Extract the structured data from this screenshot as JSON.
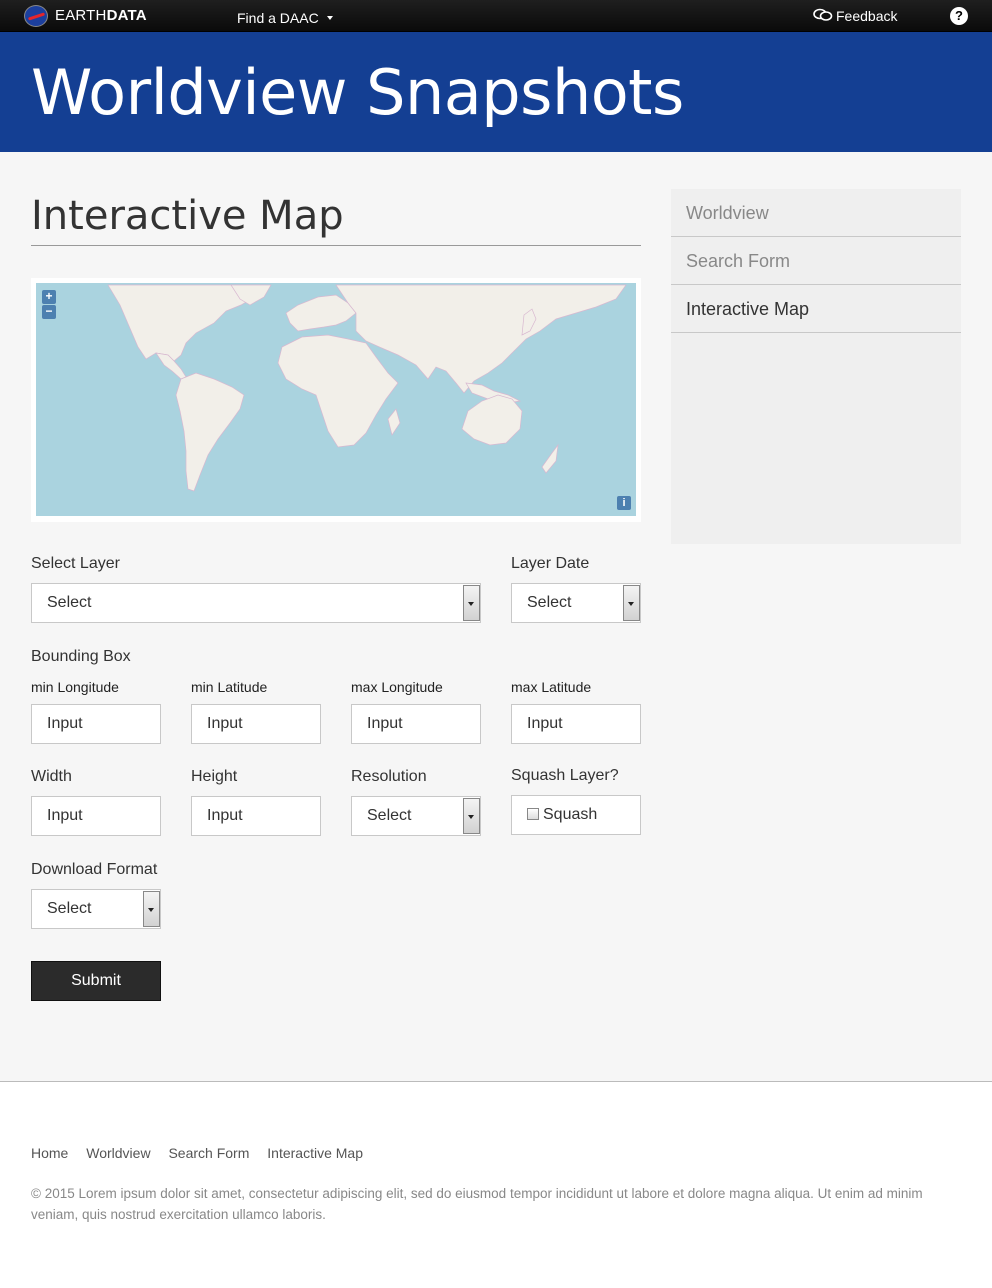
{
  "topbar": {
    "brand_light": "EARTH",
    "brand_bold": "DATA",
    "find_daac": "Find a DAAC",
    "feedback": "Feedback",
    "help": "?"
  },
  "banner": {
    "title": "Worldview Snapshots"
  },
  "main": {
    "page_title": "Interactive Map",
    "map": {
      "zoom_in": "+",
      "zoom_out": "−",
      "info": "i"
    },
    "select_layer": {
      "label": "Select Layer",
      "value": "Select"
    },
    "layer_date": {
      "label": "Layer Date",
      "value": "Select"
    },
    "bounding_box": {
      "label": "Bounding Box",
      "min_longitude": {
        "label": "min Longitude",
        "value": "Input"
      },
      "min_latitude": {
        "label": "min Latitude",
        "value": "Input"
      },
      "max_longitude": {
        "label": "max Longitude",
        "value": "Input"
      },
      "max_latitude": {
        "label": "max Latitude",
        "value": "Input"
      }
    },
    "width": {
      "label": "Width",
      "value": "Input"
    },
    "height": {
      "label": "Height",
      "value": "Input"
    },
    "resolution": {
      "label": "Resolution",
      "value": "Select"
    },
    "squash": {
      "label": "Squash Layer?",
      "checkbox_label": "Squash",
      "checked": false
    },
    "download_format": {
      "label": "Download Format",
      "value": "Select"
    },
    "submit": "Submit"
  },
  "sidebar": {
    "items": [
      {
        "label": "Worldview",
        "active": false
      },
      {
        "label": "Search Form",
        "active": false
      },
      {
        "label": "Interactive Map",
        "active": true
      }
    ]
  },
  "footer": {
    "nav": [
      "Home",
      "Worldview",
      "Search Form",
      "Interactive Map"
    ],
    "copyright": "© 2015 Lorem ipsum dolor sit amet, consectetur adipiscing elit, sed do eiusmod tempor incididunt ut labore et dolore magna aliqua. Ut enim ad minim veniam, quis nostrud exercitation ullamco laboris."
  },
  "colors": {
    "banner": "#143f93",
    "topbar": "#111111",
    "submit": "#2b2b2b",
    "ocean": "#aad3df",
    "land": "#f2efe9"
  }
}
